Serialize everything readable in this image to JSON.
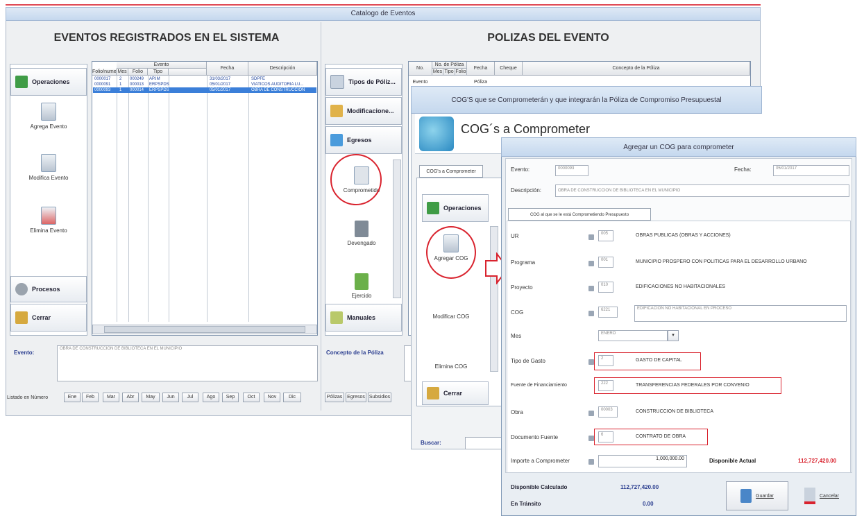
{
  "main_window": {
    "title": "Catalogo de Eventos",
    "left_heading": "EVENTOS REGISTRADOS EN EL SISTEMA",
    "right_heading": "POLIZAS DEL EVENTO"
  },
  "left_nav": {
    "operaciones": "Operaciones",
    "agrega_evento": "Agrega Evento",
    "modifica_evento": "Modifica Evento",
    "elimina_evento": "Elimina Evento",
    "procesos": "Procesos",
    "cerrar": "Cerrar"
  },
  "events_grid": {
    "group_header": "Evento",
    "columns": [
      "Folio/numero",
      "Mes",
      "Folio",
      "Tipo",
      "Fecha",
      "Descripción"
    ],
    "rows": [
      [
        "0000017",
        "2",
        "000249",
        "AP.IM",
        "31/03/2017",
        "SDPFE"
      ],
      [
        "0000091",
        "1",
        "000013",
        "ERPSPDS",
        "05/01/2017",
        "VIATICOS AUDITORIA LU..."
      ],
      [
        "0000093",
        "1",
        "000014",
        "ERPSPDS",
        "05/01/2017",
        "OBRA DE CONSTRUCCION"
      ]
    ]
  },
  "evento_field": {
    "label": "Evento:",
    "value": "OBRA DE CONSTRUCCION DE BIBLIOTECA EN EL MUNICIPIO"
  },
  "month_bar": {
    "label": "Listado en Número",
    "months": [
      "Ene",
      "Feb",
      "Mar",
      "Abr",
      "May",
      "Jun",
      "Jul",
      "Ago",
      "Sep",
      "Oct",
      "Nov",
      "Dic"
    ]
  },
  "polizas_nav": {
    "tipos": "Tipos de Póliz...",
    "modificaciones": "Modificacione...",
    "egresos": "Egresos",
    "comprometido": "Comprometido",
    "devengado": "Devengado",
    "ejercido": "Ejercido",
    "manuales": "Manuales"
  },
  "polizas_grid": {
    "columns": [
      "No. Evento",
      "No. de Póliza",
      "Fecha Póliza",
      "Cheque",
      "Concepto de la Póliza"
    ],
    "sub": [
      "Mes",
      "Tipo",
      "Folio"
    ]
  },
  "concepto": {
    "label": "Concepto de la Póliza"
  },
  "pol_tabs": [
    "Pólizas",
    "Egresos",
    "Subsidios"
  ],
  "buscar": {
    "label": "Buscar:"
  },
  "cog_window": {
    "title": "COG'S que se Comprometerán y que integrarán la Póliza de Compromiso Presupuestal",
    "heading": "COG´s a Comprometer",
    "tab": "COG's a Comprometer",
    "operaciones": "Operaciones",
    "agregar": "Agregar COG",
    "modificar": "Modificar COG",
    "eliminar": "Elimina COG",
    "cerrar": "Cerrar"
  },
  "add_window": {
    "title": "Agregar un COG para comprometer",
    "evento_label": "Evento:",
    "evento_value": "0000093",
    "fecha_label": "Fecha:",
    "fecha_value": "05/01/2017",
    "descripcion_label": "Descripción:",
    "descripcion_value": "OBRA DE CONSTRUCCION DE BIBLIOTECA EN EL MUNICIPIO",
    "tab": "COG al que se le está Comprometiendo Presupuesto",
    "fields": [
      {
        "label": "UR",
        "code": "005",
        "desc": "OBRAS PUBLICAS (OBRAS Y ACCIONES)"
      },
      {
        "label": "Programa",
        "code": "001",
        "desc": "MUNICIPIO PROSPERO CON POLITICAS PARA EL DESARROLLO URBANO"
      },
      {
        "label": "Proyecto",
        "code": "010",
        "desc": "EDIFICACIONES NO HABITACIONALES"
      },
      {
        "label": "COG",
        "code": "6221",
        "desc": "EDIFICACION NO HABITACIONAL EN PROCESO"
      },
      {
        "label": "Mes",
        "code": "ENERO",
        "desc": ""
      },
      {
        "label": "Tipo de Gasto",
        "code": "2",
        "desc": "GASTO DE CAPITAL"
      },
      {
        "label": "Fuente de Financiamiento",
        "code": "222",
        "desc": "TRANSFERENCIAS FEDERALES POR CONVENIO"
      },
      {
        "label": "Obra",
        "code": "00003",
        "desc": "CONSTRUCCION DE BIBLIOTECA"
      },
      {
        "label": "Documento Fuente",
        "code": "6",
        "desc": "CONTRATO DE OBRA"
      }
    ],
    "importe_label": "Importe a Comprometer",
    "importe_value": "1,000,000.00",
    "disponible_actual_label": "Disponible Actual",
    "disponible_actual_value": "112,727,420.00",
    "disponible_calculado_label": "Disponible Calculado",
    "disponible_calculado_value": "112,727,420.00",
    "en_transito_label": "En Tránsito",
    "en_transito_value": "0.00",
    "guardar": "Guardar",
    "cancelar": "Cancelar"
  },
  "colors": {
    "accent_red": "#d9232e",
    "title_blue": "#c5d8ee",
    "selected": "#3b7fd9"
  }
}
